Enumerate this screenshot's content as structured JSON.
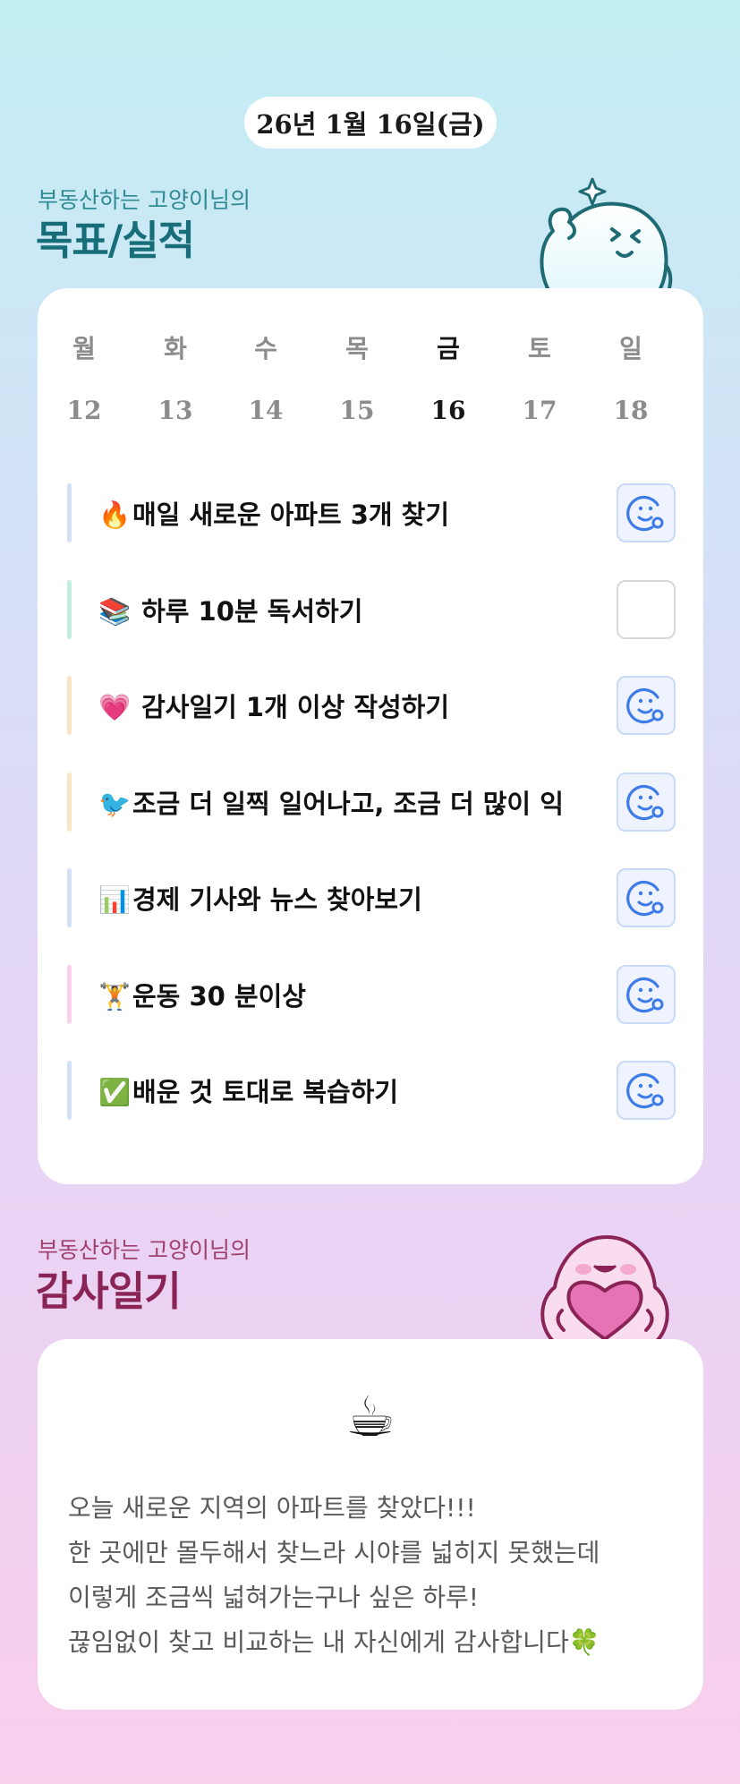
{
  "header": {
    "date": "26년 1월 16일(금)"
  },
  "goals_section": {
    "subtitle": "부동산하는 고양이님의",
    "title": "목표/실적"
  },
  "week": {
    "days": [
      "월",
      "화",
      "수",
      "목",
      "금",
      "토",
      "일"
    ],
    "dates": [
      "12",
      "13",
      "14",
      "15",
      "16",
      "17",
      "18"
    ],
    "active_index": 4
  },
  "goals": [
    {
      "emoji": "🔥",
      "text": "매일 새로운 아파트 3개 찾기",
      "done": true,
      "bar_color": "#d3e0fa"
    },
    {
      "emoji": "📚",
      "text": " 하루 10분 독서하기",
      "done": false,
      "bar_color": "#c2efdd"
    },
    {
      "emoji": "💗",
      "text": " 감사일기 1개 이상 작성하기",
      "done": true,
      "bar_color": "#fde3c5"
    },
    {
      "emoji": "🐦",
      "text": "조금 더 일찍 일어나고, 조금 더 많이 익",
      "done": true,
      "bar_color": "#fde3c5"
    },
    {
      "emoji": "📊",
      "text": "경제 기사와 뉴스 찾아보기",
      "done": true,
      "bar_color": "#d3e0fa"
    },
    {
      "emoji": "🏋",
      "text": "운동 30 분이상",
      "done": true,
      "bar_color": "#fad3ea"
    },
    {
      "emoji": "✅",
      "text": "배운 것 토대로 복습하기",
      "done": true,
      "bar_color": "#d3e0fa"
    }
  ],
  "diary_section": {
    "subtitle": "부동산하는 고양이님의",
    "title": "감사일기"
  },
  "diary": {
    "icon": "☕",
    "lines": [
      "오늘 새로운 지역의 아파트를 찾았다!!!",
      "한 곳에만 몰두해서 찾느라 시야를 넓히지 못했는데",
      "이렇게 조금씩 넓혀가는구나 싶은 하루!",
      "끊임없이 찾고 비교하는 내 자신에게 감사합니다🍀"
    ]
  },
  "colors": {
    "teal_title": "#176e78",
    "pink_title": "#8a2356",
    "check_blue": "#3d7be8"
  }
}
